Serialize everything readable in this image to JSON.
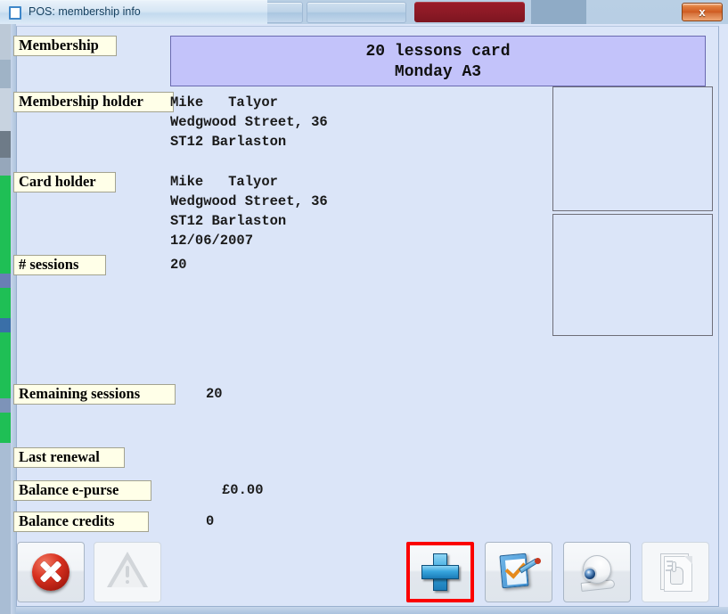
{
  "window": {
    "title": "POS: membership info",
    "icon": "window-icon",
    "close_label": "x"
  },
  "membership": {
    "label": "Membership",
    "line1": "20 lessons card",
    "line2": "Monday A3"
  },
  "membership_holder": {
    "label": "Membership holder",
    "line1": "Mike   Talyor",
    "line2": "Wedgwood Street, 36",
    "line3": "ST12 Barlaston"
  },
  "card_holder": {
    "label": "Card holder",
    "line1": "Mike   Talyor",
    "line2": "Wedgwood Street, 36",
    "line3": "ST12 Barlaston",
    "line4": "12/06/2007"
  },
  "sessions": {
    "label": "# sessions",
    "value": "20"
  },
  "remaining_sessions": {
    "label": "Remaining sessions",
    "value": "20"
  },
  "last_renewal": {
    "label": "Last renewal",
    "value": ""
  },
  "balance_epurse": {
    "label": "Balance e-purse",
    "value": "£0.00"
  },
  "balance_credits": {
    "label": "Balance credits",
    "value": "0"
  },
  "toolbar": {
    "buttons": [
      {
        "name": "cancel-button",
        "icon": "red-x-icon",
        "enabled": true
      },
      {
        "name": "warning-button",
        "icon": "warning-triangle-icon",
        "enabled": false
      },
      {
        "name": "add-button",
        "icon": "blue-plus-icon",
        "enabled": true,
        "highlighted": true
      },
      {
        "name": "edit-button",
        "icon": "checklist-pencil-icon",
        "enabled": true
      },
      {
        "name": "webcam-button",
        "icon": "webcam-icon",
        "enabled": true
      },
      {
        "name": "signature-button",
        "icon": "document-hand-icon",
        "enabled": false
      }
    ]
  },
  "colors": {
    "client_background": "#dbe5f8",
    "banner_background": "#c3c3fa",
    "label_background": "#ffffe8",
    "highlight_border": "#fb0000",
    "accent_green_strip": "#1fbf55"
  }
}
